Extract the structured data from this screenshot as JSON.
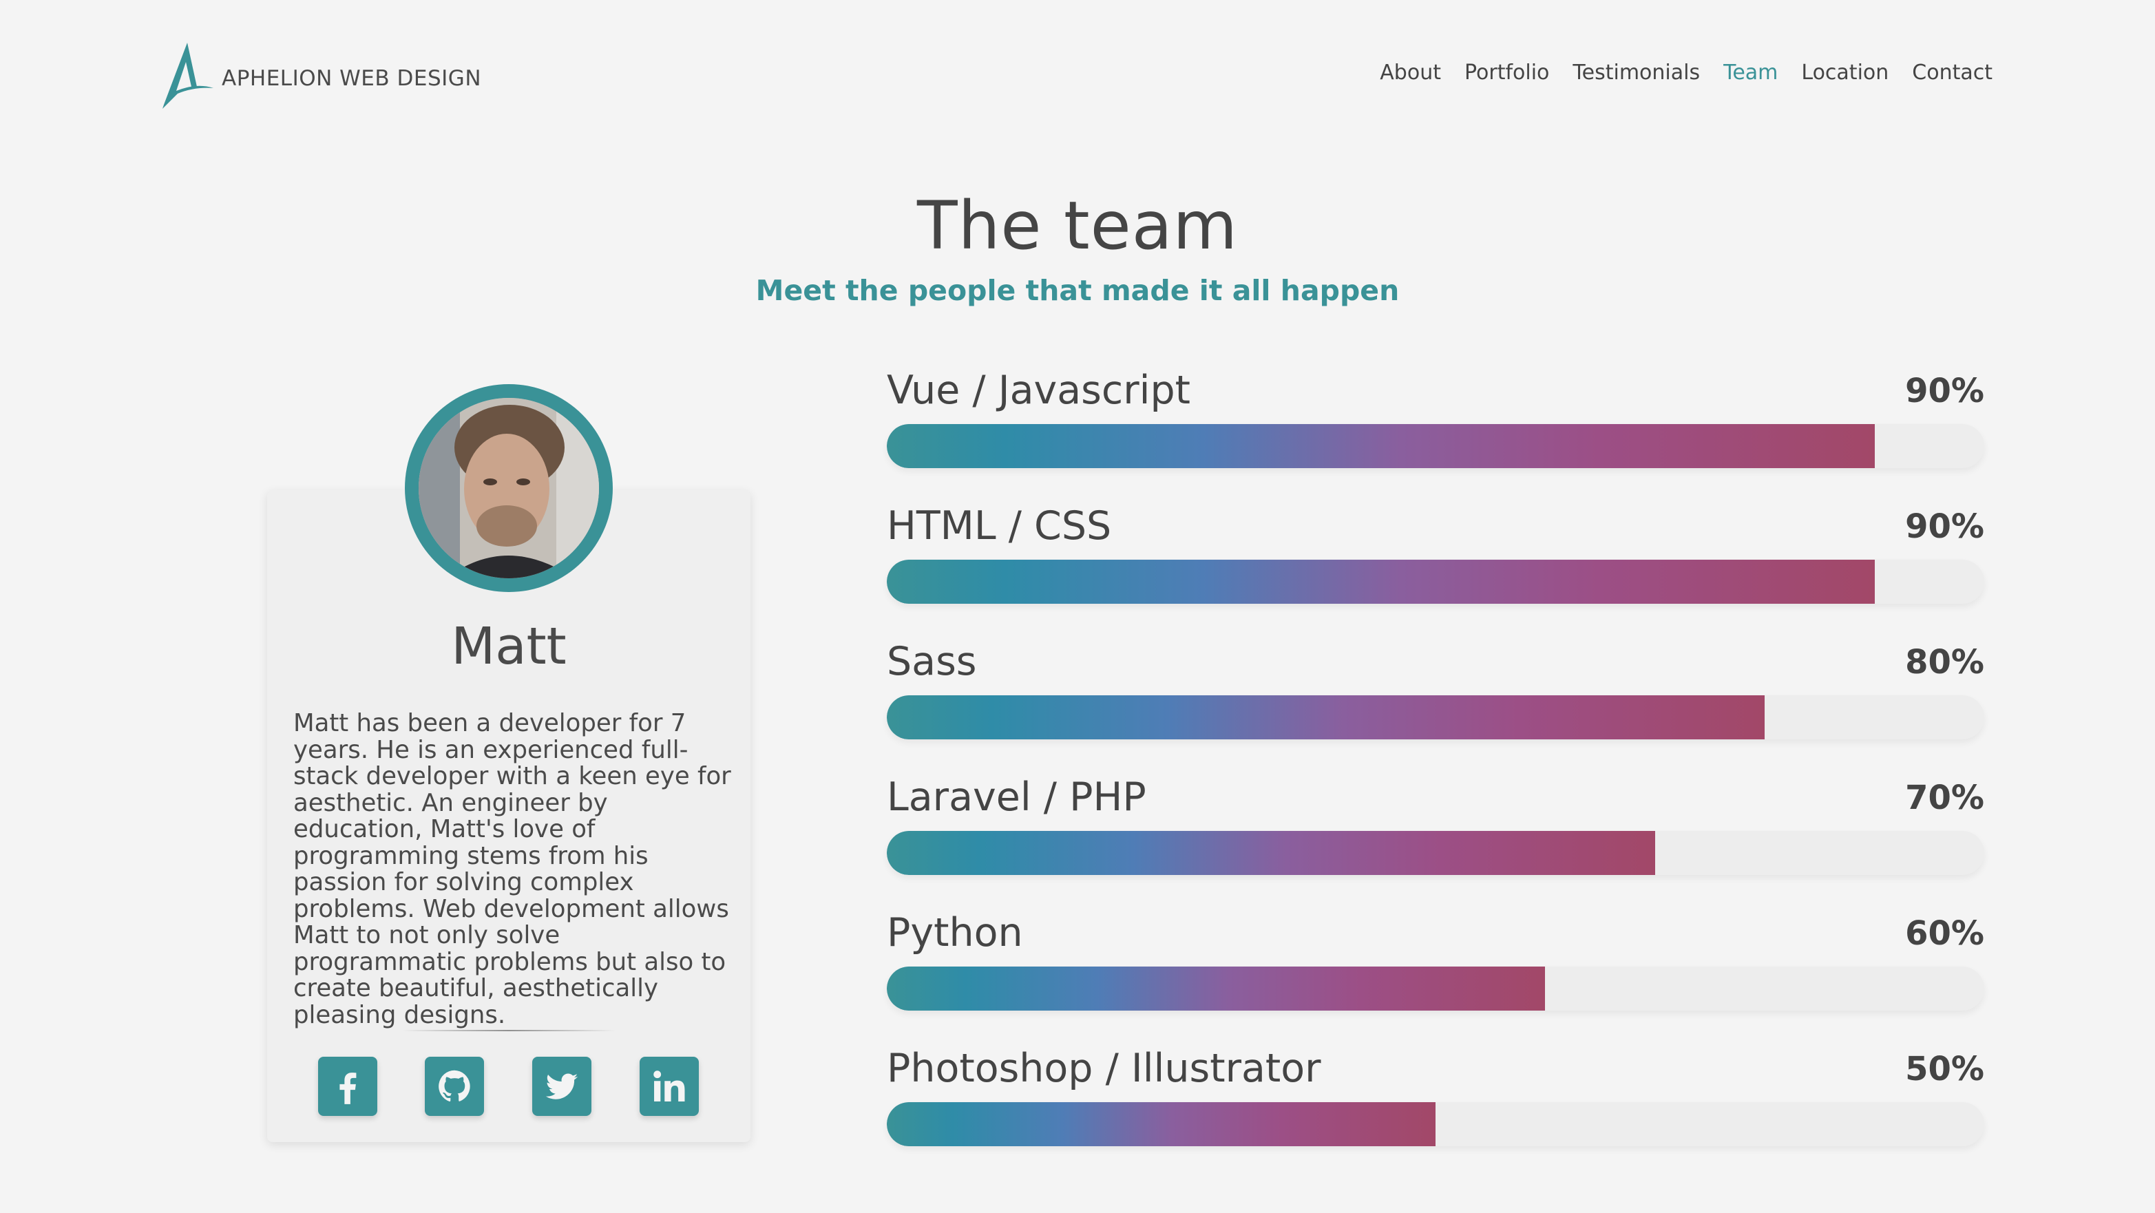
{
  "brand": {
    "name": "APHELION WEB DESIGN",
    "color": "#3a9297"
  },
  "nav": [
    {
      "label": "About",
      "active": false
    },
    {
      "label": "Portfolio",
      "active": false
    },
    {
      "label": "Testimonials",
      "active": false
    },
    {
      "label": "Team",
      "active": true
    },
    {
      "label": "Location",
      "active": false
    },
    {
      "label": "Contact",
      "active": false
    }
  ],
  "section": {
    "title": "The team",
    "subtitle": "Meet the people that made it all happen"
  },
  "member": {
    "name": "Matt",
    "bio": "Matt has been a developer for 7 years. He is an experienced full-stack developer with a keen eye for aesthetic. An engineer by education, Matt's love of programming stems from his passion for solving complex problems. Web development allows Matt to not only solve programmatic problems but also to create beautiful, aesthetically pleasing designs.",
    "socials": [
      "facebook-icon",
      "github-icon",
      "twitter-icon",
      "linkedin-icon"
    ]
  },
  "skills": [
    {
      "name": "Vue / Javascript",
      "percent_label": "90%",
      "value": 90
    },
    {
      "name": "HTML / CSS",
      "percent_label": "90%",
      "value": 90
    },
    {
      "name": "Sass",
      "percent_label": "80%",
      "value": 80
    },
    {
      "name": "Laravel / PHP",
      "percent_label": "70%",
      "value": 70
    },
    {
      "name": "Python",
      "percent_label": "60%",
      "value": 60
    },
    {
      "name": "Photoshop / Illustrator",
      "percent_label": "50%",
      "value": 50
    }
  ]
}
